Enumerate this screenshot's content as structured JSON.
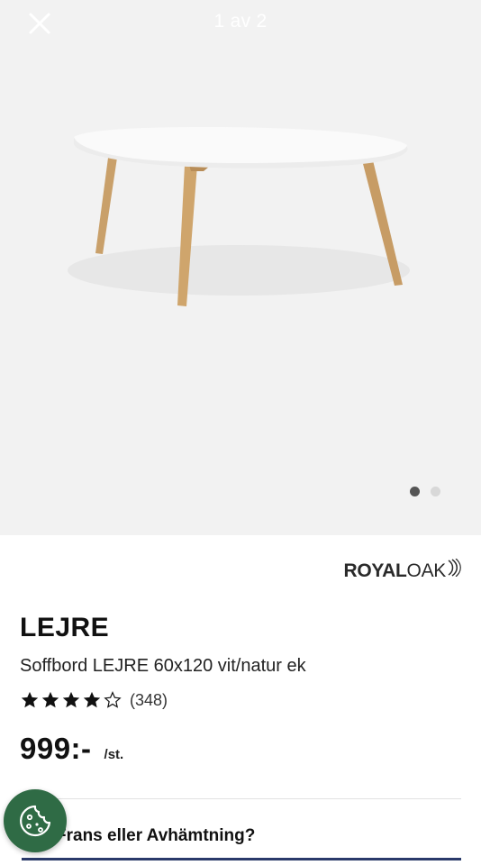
{
  "gallery": {
    "counter": "1 av 2",
    "total_images": 2,
    "active_index": 0
  },
  "brand": {
    "name_bold": "ROYAL",
    "name_light": "OAK"
  },
  "product": {
    "title": "LEJRE",
    "subtitle": "Soffbord LEJRE 60x120 vit/natur ek",
    "rating_stars": 4,
    "rating_max": 5,
    "review_count": "(348)",
    "price": "999:-",
    "price_unit": "/st."
  },
  "delivery": {
    "label": "Frans eller Avhämtning?"
  },
  "colors": {
    "gallery_bg": "#f2f2f2",
    "cookie_button": "#2f6b45",
    "accent_underline": "#2a3a6a"
  },
  "icons": {
    "close": "close-icon",
    "star_filled": "star-filled-icon",
    "star_empty": "star-outline-icon",
    "cookie": "cookie-icon",
    "brand_mark": "royal-oak-waves-icon"
  }
}
